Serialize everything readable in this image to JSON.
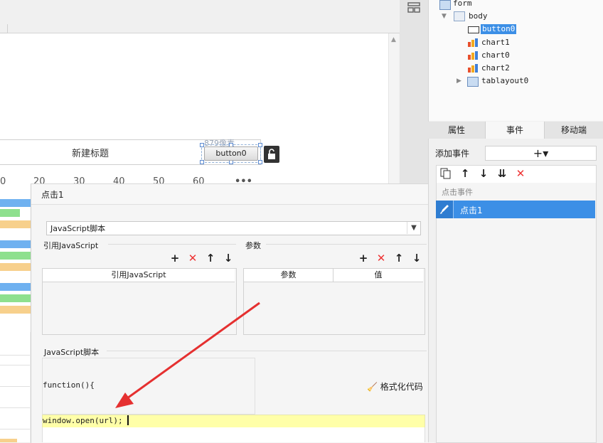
{
  "canvas": {
    "title_text": "新建标题",
    "button_label": "button0",
    "size_label": "879像素",
    "axis_ticks": [
      "0",
      "20",
      "30",
      "40",
      "50",
      "60",
      "•••"
    ]
  },
  "dialog": {
    "title": "点击1",
    "type_select_value": "JavaScript脚本",
    "ref_js_section": "引用JavaScript",
    "params_section": "参数",
    "ref_js_column": "引用JavaScript",
    "params_columns": [
      "参数",
      "值"
    ],
    "script_section": "JavaScript脚本",
    "code_line1": "function(){",
    "code_line2": "window.open(url);",
    "format_label": "格式化代码"
  },
  "tree": {
    "items": [
      "form",
      "body",
      "button0",
      "chart1",
      "chart0",
      "chart2",
      "tablayout0"
    ]
  },
  "tabs": [
    "属性",
    "事件",
    "移动端"
  ],
  "events": {
    "add_label": "添加事件",
    "add_button": "+▾",
    "category": "点击事件",
    "item": "点击1"
  },
  "colors": {
    "selection_blue": "#3c8fe6",
    "code_highlight": "#ffffa8",
    "delete_red": "#e33333"
  }
}
